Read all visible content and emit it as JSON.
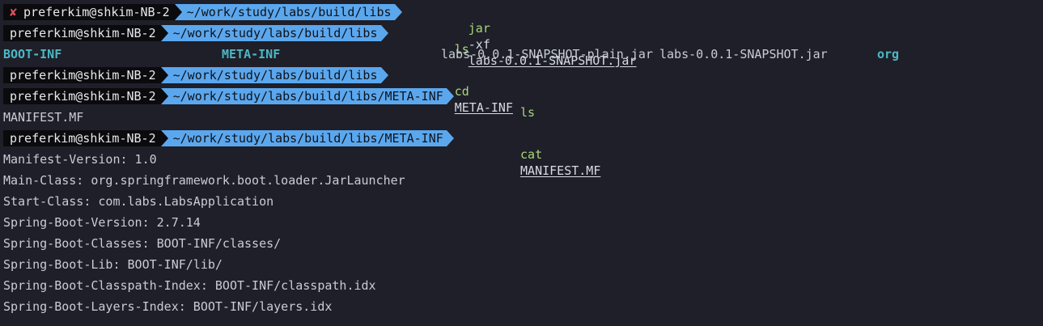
{
  "prompt": {
    "user_host": "preferkim@shkim-NB-2",
    "error_symbol": "✘",
    "dir_libs": "~/work/study/labs/build/libs",
    "dir_meta": "~/work/study/labs/build/libs/META-INF"
  },
  "commands": {
    "c1_name": "jar",
    "c1_flag": "-xf",
    "c1_path": "labs-0.0.1-SNAPSHOT.jar",
    "c2_name": "ls",
    "c3_name": "cd",
    "c3_path": "META-INF",
    "c4_name": "ls",
    "c5_name": "cat",
    "c5_path": "MANIFEST.MF"
  },
  "ls_output_1": {
    "item1": "BOOT-INF",
    "item2": "META-INF",
    "item3": "labs-0.0.1-SNAPSHOT-plain.jar",
    "item4": "labs-0.0.1-SNAPSHOT.jar",
    "item5": "org"
  },
  "ls_output_2": "MANIFEST.MF",
  "manifest": [
    "Manifest-Version: 1.0",
    "Main-Class: org.springframework.boot.loader.JarLauncher",
    "Start-Class: com.labs.LabsApplication",
    "Spring-Boot-Version: 2.7.14",
    "Spring-Boot-Classes: BOOT-INF/classes/",
    "Spring-Boot-Lib: BOOT-INF/lib/",
    "Spring-Boot-Classpath-Index: BOOT-INF/classpath.idx",
    "Spring-Boot-Layers-Index: BOOT-INF/layers.idx"
  ],
  "colors": {
    "background": "#1e1f29",
    "prompt_user_bg": "#0b0b0e",
    "prompt_dir_bg": "#5ba7ee",
    "error": "#e04f5f",
    "command": "#a9d676",
    "directory_listing": "#4bb8c4"
  }
}
